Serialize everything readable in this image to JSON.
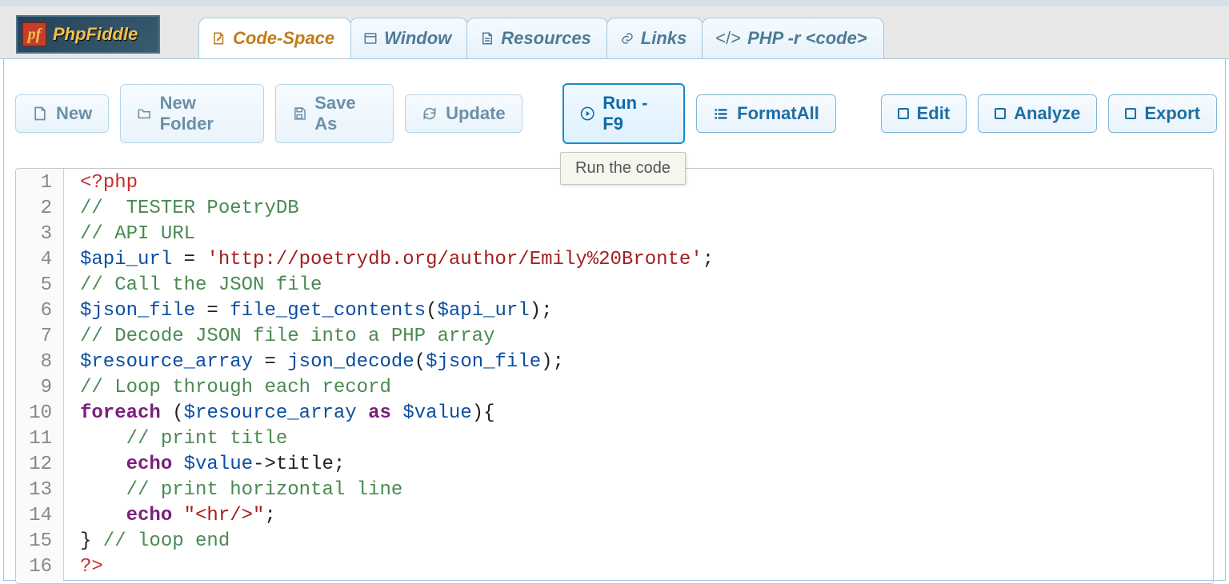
{
  "logo": {
    "badge": "pf",
    "text": "PhpFiddle"
  },
  "tabs": [
    {
      "id": "code-space",
      "label": "Code-Space",
      "active": true
    },
    {
      "id": "window",
      "label": "Window"
    },
    {
      "id": "resources",
      "label": "Resources"
    },
    {
      "id": "links",
      "label": "Links"
    },
    {
      "id": "php-r",
      "label": "PHP -r <code>"
    }
  ],
  "toolbar": {
    "new": "New",
    "new_folder": "New Folder",
    "save_as": "Save As",
    "update": "Update",
    "run": "Run - F9",
    "format_all": "FormatAll",
    "edit": "Edit",
    "analyze": "Analyze",
    "export": "Export"
  },
  "tooltip": "Run the code",
  "code": {
    "lines": [
      {
        "n": "1",
        "t": "php_open"
      },
      {
        "n": "2",
        "t": "comment",
        "text": "//  TESTER PoetryDB"
      },
      {
        "n": "3",
        "t": "comment",
        "text": "// API URL"
      },
      {
        "n": "4",
        "t": "assign_str",
        "var": "$api_url",
        "val": "'http://poetrydb.org/author/Emily%20Bronte'"
      },
      {
        "n": "5",
        "t": "comment",
        "text": "// Call the JSON file"
      },
      {
        "n": "6",
        "t": "assign_call",
        "var": "$json_file",
        "fn": "file_get_contents",
        "arg": "$api_url"
      },
      {
        "n": "7",
        "t": "comment",
        "text": "// Decode JSON file into a PHP array"
      },
      {
        "n": "8",
        "t": "assign_call",
        "var": "$resource_array",
        "fn": "json_decode",
        "arg": "$json_file"
      },
      {
        "n": "9",
        "t": "comment",
        "text": "// Loop through each record"
      },
      {
        "n": "10",
        "t": "foreach",
        "arr": "$resource_array",
        "as": "$value"
      },
      {
        "n": "11",
        "t": "comment_ind",
        "text": "    // print title"
      },
      {
        "n": "12",
        "t": "echo_prop",
        "var": "$value",
        "prop": "title"
      },
      {
        "n": "13",
        "t": "comment_ind",
        "text": "    // print horizontal line"
      },
      {
        "n": "14",
        "t": "echo_str",
        "val": "\"<hr/>\""
      },
      {
        "n": "15",
        "t": "close_brace",
        "tail": " // loop end"
      },
      {
        "n": "16",
        "t": "php_close"
      }
    ]
  }
}
